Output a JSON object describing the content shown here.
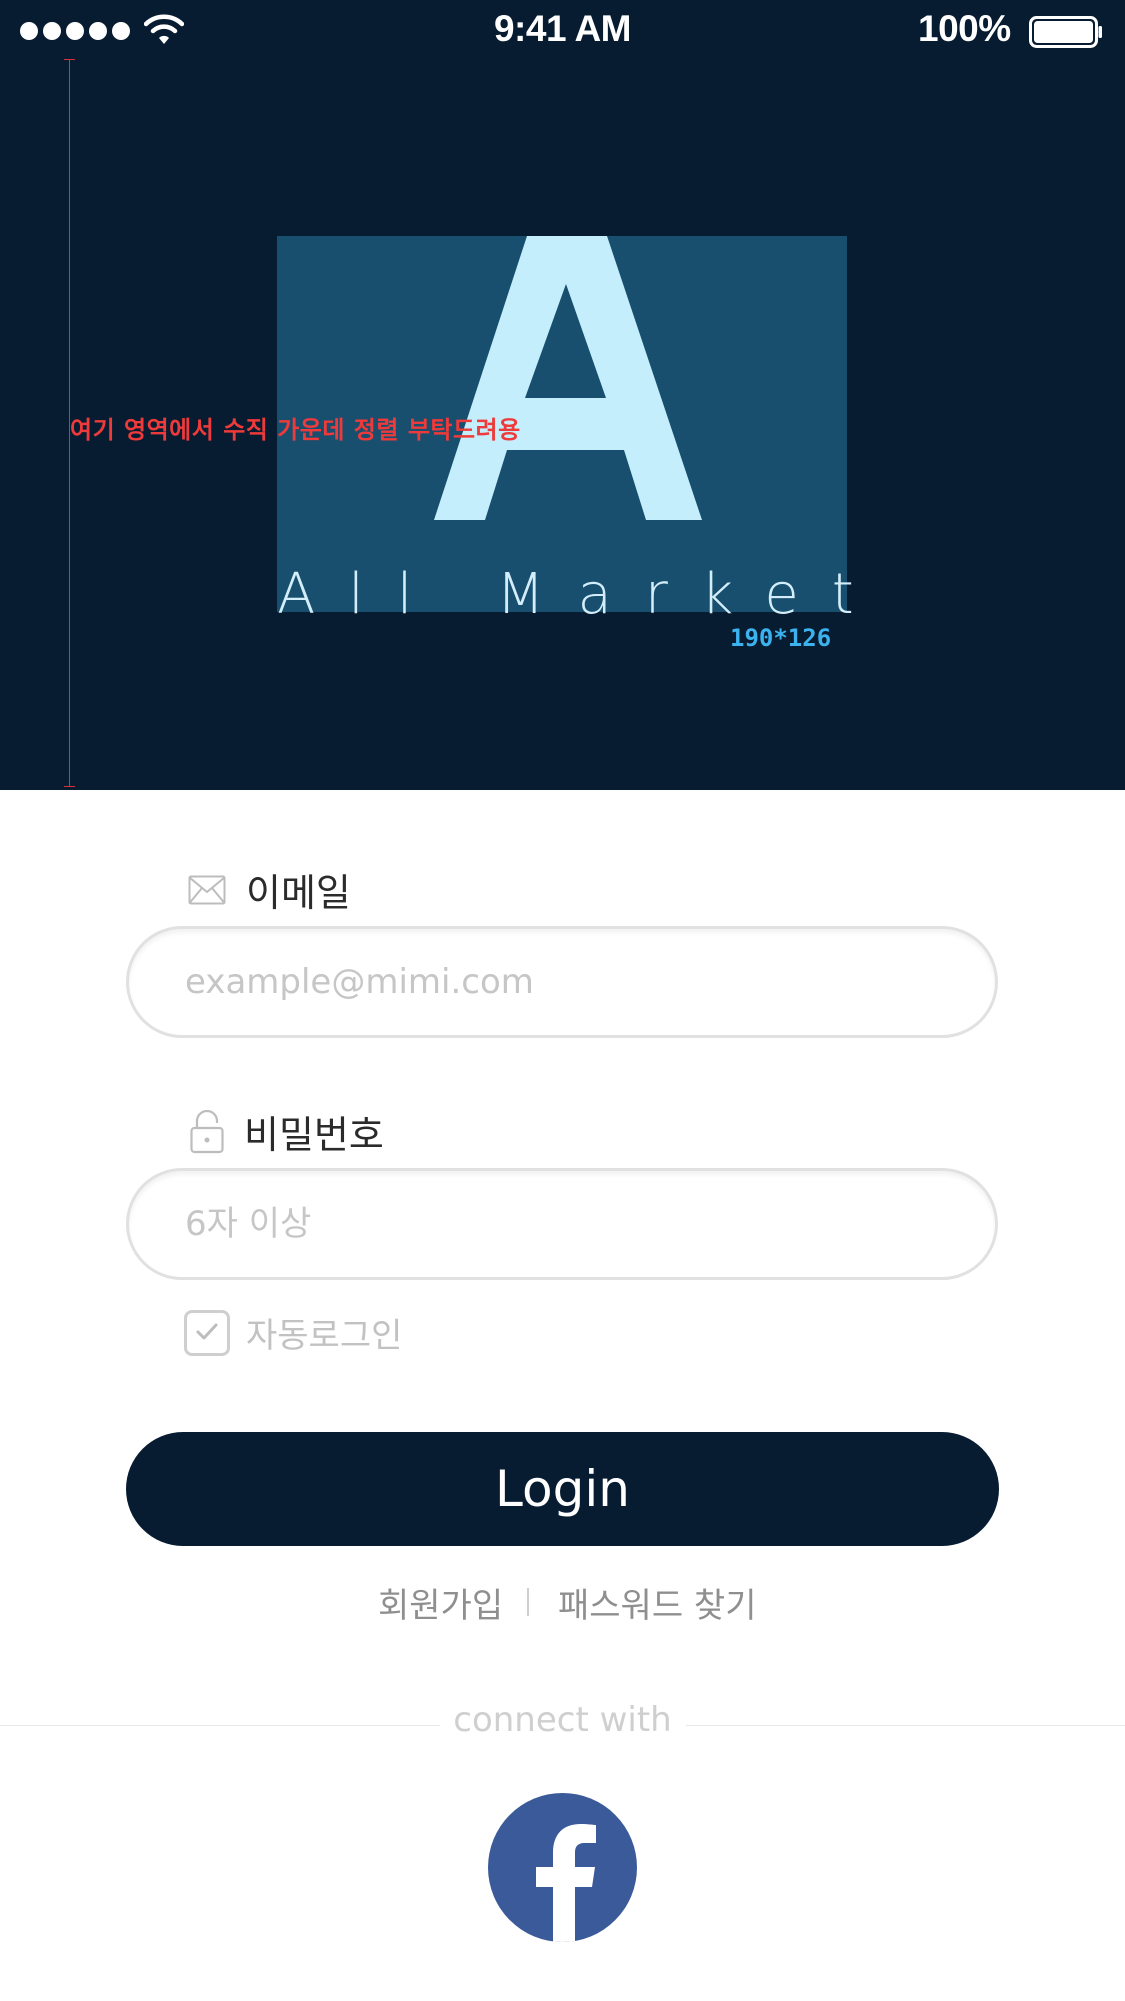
{
  "status_bar": {
    "time": "9:41 AM",
    "battery": "100%",
    "signal_icon": "signal-dots-icon",
    "wifi_icon": "wifi-icon",
    "battery_icon": "battery-icon"
  },
  "header": {
    "guide_note": "여기 영역에서 수직 가운데 정렬 부탁드려용",
    "logo_letter": "A",
    "logo_wordmark": "All Market",
    "size_note": "190*126",
    "colors": {
      "background": "#071c31",
      "logo_box": "#184f6f",
      "logo_letter": "#c5eefc",
      "guide": "#ee3a3a",
      "size_note": "#3cb3ee"
    }
  },
  "form": {
    "email": {
      "label": "이메일",
      "placeholder": "example@mimi.com",
      "icon": "envelope-icon"
    },
    "password": {
      "label": "비밀번호",
      "placeholder": "6자 이상",
      "icon": "lock-icon"
    },
    "auto_login": {
      "label": "자동로그인",
      "checked": false,
      "icon": "checkmark-icon"
    },
    "login_button": "Login"
  },
  "links": {
    "signup": "회원가입",
    "find_password": "패스워드 찾기"
  },
  "social": {
    "connect_label": "connect with",
    "facebook_icon": "facebook-icon",
    "facebook_color": "#3b5a99"
  }
}
